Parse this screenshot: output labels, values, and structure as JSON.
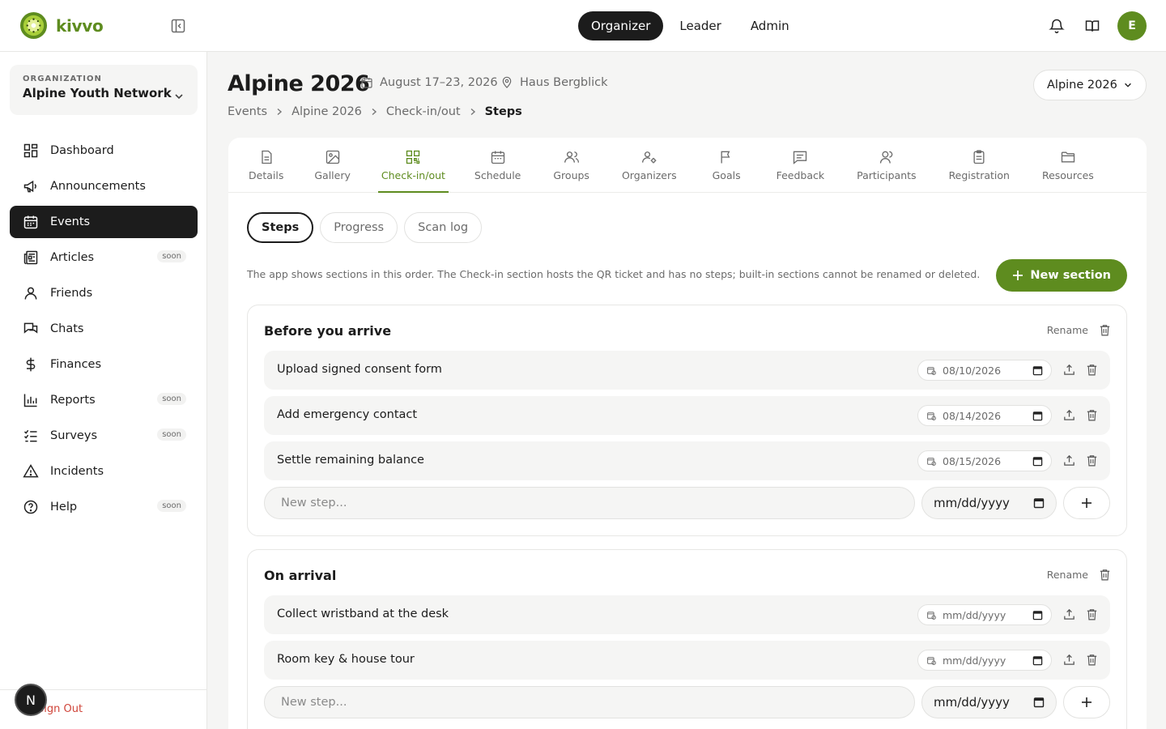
{
  "brand": {
    "name": "kivvo",
    "accent": "#5e8c1f"
  },
  "header": {
    "roles": [
      "Organizer",
      "Leader",
      "Admin"
    ],
    "active_role": "Organizer",
    "avatar_initial": "E",
    "icons": [
      "bell-icon",
      "book-open-icon"
    ]
  },
  "sidebar": {
    "org_label": "ORGANIZATION",
    "org_name": "Alpine Youth Network",
    "items": [
      {
        "label": "Dashboard",
        "icon": "dashboard-icon",
        "soon": ""
      },
      {
        "label": "Announcements",
        "icon": "megaphone-icon",
        "soon": ""
      },
      {
        "label": "Events",
        "icon": "calendar-icon",
        "soon": "",
        "active": true
      },
      {
        "label": "Articles",
        "icon": "newspaper-icon",
        "soon": "soon"
      },
      {
        "label": "Friends",
        "icon": "user-icon",
        "soon": ""
      },
      {
        "label": "Chats",
        "icon": "chat-icon",
        "soon": ""
      },
      {
        "label": "Finances",
        "icon": "dollar-icon",
        "soon": ""
      },
      {
        "label": "Reports",
        "icon": "bar-chart-icon",
        "soon": "soon"
      },
      {
        "label": "Surveys",
        "icon": "checklist-icon",
        "soon": "soon"
      },
      {
        "label": "Incidents",
        "icon": "warning-icon",
        "soon": ""
      },
      {
        "label": "Help",
        "icon": "help-icon",
        "soon": "soon"
      }
    ],
    "sign_out": "Sign Out",
    "dev_badge": "N"
  },
  "event": {
    "title": "Alpine 2026",
    "dates": "August 17–23, 2026",
    "location": "Haus Bergblick",
    "selector": "Alpine 2026"
  },
  "breadcrumb": [
    "Events",
    "Alpine 2026",
    "Check-in/out",
    "Steps"
  ],
  "tabs": [
    {
      "label": "Details",
      "icon": "document-icon"
    },
    {
      "label": "Gallery",
      "icon": "image-icon"
    },
    {
      "label": "Check-in/out",
      "icon": "qr-code-icon",
      "active": true
    },
    {
      "label": "Schedule",
      "icon": "calendar-icon"
    },
    {
      "label": "Groups",
      "icon": "users-icon"
    },
    {
      "label": "Organizers",
      "icon": "user-cog-icon"
    },
    {
      "label": "Goals",
      "icon": "flag-icon"
    },
    {
      "label": "Feedback",
      "icon": "message-icon"
    },
    {
      "label": "Participants",
      "icon": "users-icon"
    },
    {
      "label": "Registration",
      "icon": "clipboard-icon"
    },
    {
      "label": "Resources",
      "icon": "folder-icon"
    }
  ],
  "subtabs": [
    "Steps",
    "Progress",
    "Scan log"
  ],
  "hint": "The app shows sections in this order. The Check-in section hosts the QR ticket and has no steps; built-in sections cannot be renamed or deleted.",
  "new_section_label": "New section",
  "rename_label": "Rename",
  "new_step_placeholder": "New step...",
  "date_placeholder": "mm/dd/yyyy",
  "sections": [
    {
      "title": "Before you arrive",
      "steps": [
        {
          "label": "Upload signed consent form",
          "date": "08/10/2026"
        },
        {
          "label": "Add emergency contact",
          "date": "08/14/2026"
        },
        {
          "label": "Settle remaining balance",
          "date": "08/15/2026"
        }
      ]
    },
    {
      "title": "On arrival",
      "steps": [
        {
          "label": "Collect wristband at the desk",
          "date": "mm/dd/yyyy"
        },
        {
          "label": "Room key & house tour",
          "date": "mm/dd/yyyy"
        }
      ]
    }
  ]
}
